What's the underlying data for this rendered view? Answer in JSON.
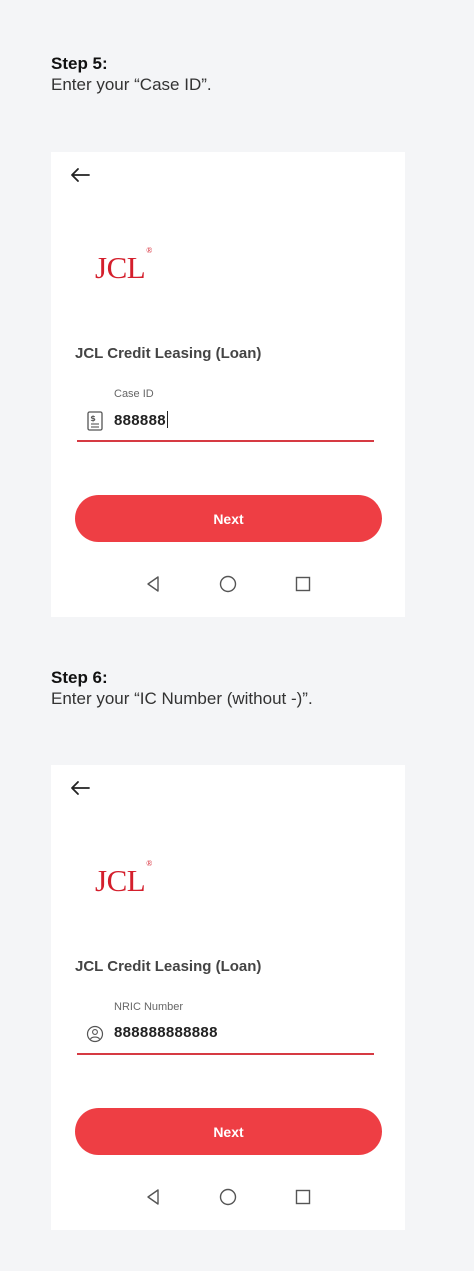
{
  "steps": [
    {
      "title": "Step 5:",
      "description": "Enter your “Case ID”.",
      "screen": {
        "logo_text": "JCL",
        "logo_mark": "®",
        "app_title": "JCL Credit Leasing (Loan)",
        "field_label": "Case ID",
        "field_icon": "invoice-document-icon",
        "field_value": "888888",
        "button_label": "Next"
      }
    },
    {
      "title": "Step 6:",
      "description": "Enter your “IC Number (without -)”.",
      "screen": {
        "logo_text": "JCL",
        "logo_mark": "®",
        "app_title": "JCL Credit Leasing (Loan)",
        "field_label": "NRIC Number",
        "field_icon": "user-circle-icon",
        "field_value": "888888888888",
        "button_label": "Next"
      }
    }
  ],
  "colors": {
    "page_background": "#f4f5f7",
    "brand_red": "#d41f2c",
    "button_red": "#ee3e44",
    "underline_red": "#d63a43"
  }
}
